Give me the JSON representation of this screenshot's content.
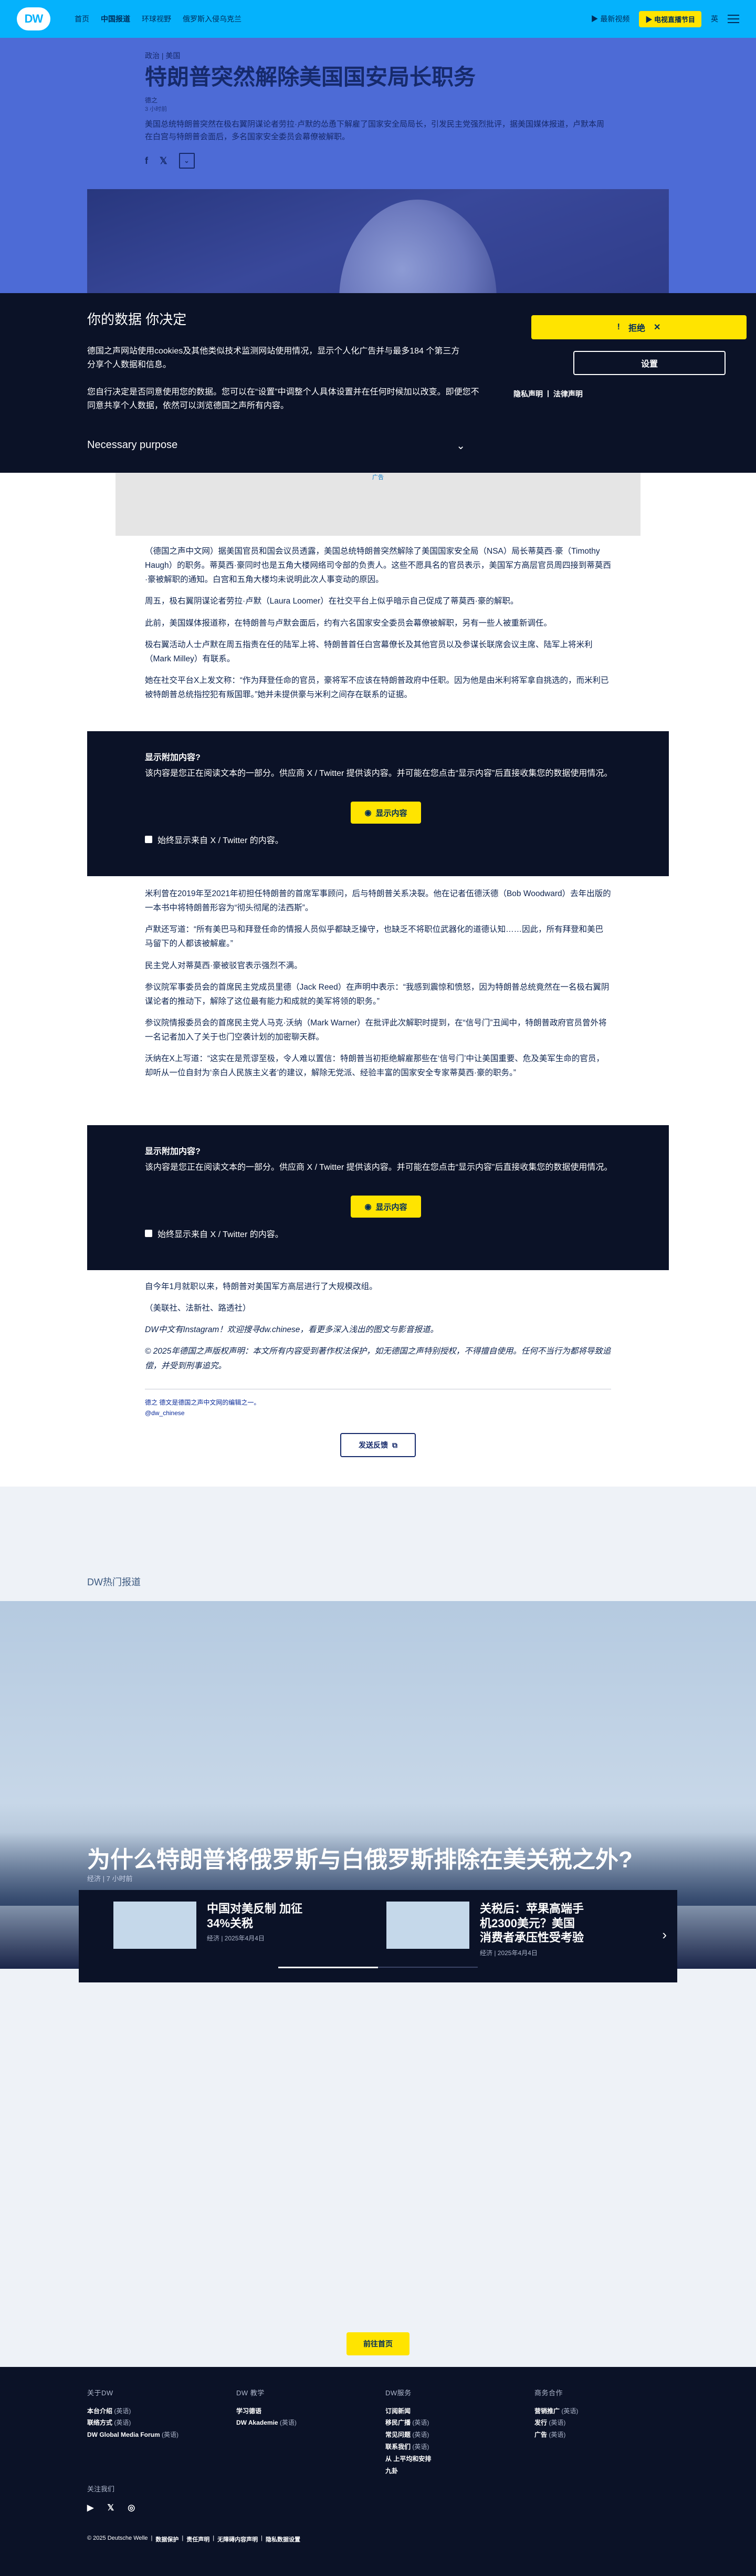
{
  "header": {
    "logo": "DW",
    "nav": [
      "首页",
      "中国报道",
      "环球视野",
      "俄罗斯入侵乌克兰"
    ],
    "active_nav": "中国报道",
    "latest_videos": "最新视频",
    "live_pill": "电视直播节目",
    "lang": "英"
  },
  "article": {
    "kicker": "政治 | 美国",
    "title": "特朗普突然解除美国国安局长职务",
    "author": "德之",
    "time": "3 小时前",
    "lead": "美国总统特朗普突然在极右翼阴谋论者劳拉·卢默的怂恿下解雇了国家安全局局长，引发民主党强烈批评，据美国媒体报道，卢默本周在白宫与特朗普会面后，多名国家安全委员会幕僚被解职。",
    "share": [
      "f",
      "𝕏",
      "⌄"
    ]
  },
  "cookie": {
    "title": "你的数据 你决定",
    "p1": "德国之声网站使用cookies及其他类似技术监测网站使用情况，显示个人化广告并与最多184 个第三方分享个人数据和信息。",
    "p2": "您自行决定是否同意使用您的数据。您可以在“设置”中调整个人具体设置并在任何时候加以改变。即便您不同意共享个人数据，依然可以浏览德国之声所有内容。",
    "purpose": "Necessary purpose",
    "reject": "拒绝",
    "settings": "设置",
    "privacy": "隐私声明",
    "legal": "法律声明"
  },
  "ad": {
    "label": "广告"
  },
  "body1": [
    "（德国之声中文网）据美国官员和国会议员透露，美国总统特朗普突然解除了美国国家安全局（NSA）局长蒂莫西·豪（Timothy Haugh）的职务。蒂莫西·豪同时也是五角大楼网络司令部的负责人。这些不愿具名的官员表示，美国军方高层官员周四接到蒂莫西·豪被解职的通知。白宫和五角大楼均未说明此次人事变动的原因。",
    "周五，极右翼阴谋论者劳拉·卢默（Laura Loomer）在社交平台上似乎暗示自己促成了蒂莫西·豪的解职。",
    "此前，美国媒体报道称，在特朗普与卢默会面后，约有六名国家安全委员会幕僚被解职，另有一些人被重新调任。",
    "极右翼活动人士卢默在周五指责在任的陆军上将、特朗普首任白宫幕僚长及其他官员以及参谋长联席会议主席、陆军上将米利（Mark Milley）有联系。",
    "她在社交平台X上发文称：“作为拜登任命的官员，豪将军不应该在特朗普政府中任职。因为他是由米利将军拿自挑选的，而米利已被特朗普总统指控犯有叛国罪。”她并未提供豪与米利之间存在联系的证据。"
  ],
  "embed": {
    "title": "显示附加内容?",
    "desc": "该内容是您正在阅读文本的一部分。供应商 X / Twitter 提供该内容。并可能在您点击“显示内容”后直接收集您的数据使用情况。",
    "button": "显示内容",
    "always": "始终显示来自 X / Twitter 的内容。"
  },
  "body2": [
    "米利曾在2019年至2021年初担任特朗普的首席军事顾问，后与特朗普关系决裂。他在记者伍德沃德（Bob Woodward）去年出版的一本书中将特朗普形容为“彻头彻尾的法西斯”。",
    "卢默还写道：“所有美巴马和拜登任命的情报人员似乎都缺乏操守，也缺乏不将职位武器化的道德认知……因此，所有拜登和美巴马留下的人都该被解雇。”",
    "民主党人对蒂莫西·豪被驳官表示强烈不满。",
    "参议院军事委员会的首席民主党成员里德（Jack Reed）在声明中表示：“我感到震惊和愤怒，因为特朗普总统竟然在一名极右翼阴谋论者的推动下，解除了这位最有能力和成就的美军将领的职务。”",
    "参议院情报委员会的首席民主党人马克·沃纳（Mark Warner）在批评此次解职时提到，在“信号门”丑闻中，特朗普政府官员曾外将一名记者加入了关于也门空袭计划的加密聊天群。",
    "沃纳在X上写道：“这实在是荒谬至极，令人难以置信：特朗普当初拒绝解雇那些在‘信号门’中让美国重要、危及美军生命的官员，却听从一位自封为‘亲白人民族主义者’的建议，解除无党派、经验丰富的国家安全专家蒂莫西·豪的职务。”"
  ],
  "body3": [
    "自今年1月就职以来，特朗普对美国军方高层进行了大规模改组。",
    "（美联社、法新社、路透社）",
    "DW中文有Instagram！欢迎搜寻dw.chinese，看更多深入浅出的图文与影音报道。",
    "© 2025年德国之声版权声明：本文所有内容受到著作权法保护，如无德国之声特别授权，不得擅自使用。任何不当行为都将导致追偿，并受到刑事追究。"
  ],
  "tags": {
    "line1": "德之 德文是德国之声中文网的编辑之一。",
    "line2": "@dw_chinese"
  },
  "feedback": "发送反馈",
  "hot": {
    "label": "DW热门报道",
    "title": "为什么特朗普将俄罗斯与白俄罗斯排除在美关税之外?",
    "meta": "经济 | 7 小时前",
    "cards": [
      {
        "title": "中国对美反制 加征34%关税",
        "meta": "经济 | 2025年4月4日"
      },
      {
        "title": "关税后：苹果高端手机2300美元？美国消费者承压性受考验",
        "meta": "经济 | 2025年4月4日"
      }
    ],
    "next": "›"
  },
  "more_button": "前往首页",
  "footer": {
    "cols": [
      {
        "heading": "关于DW",
        "items": [
          [
            "本台介绍",
            "(英语)"
          ],
          [
            "联络方式",
            "(英语)"
          ],
          [
            "DW Global Media Forum",
            "(英语)"
          ]
        ]
      },
      {
        "heading": "DW 教学",
        "items": [
          [
            "学习德语",
            ""
          ],
          [
            "DW Akademie",
            "(英语)"
          ]
        ]
      },
      {
        "heading": "DW服务",
        "items": [
          [
            "订阅新闻",
            ""
          ],
          [
            "移民广播",
            "(英语)"
          ],
          [
            "常见问题",
            "(英语)"
          ],
          [
            "联系我们",
            "(英语)"
          ],
          [
            "从 上平均和安排",
            ""
          ],
          [
            "九卦",
            ""
          ]
        ]
      },
      {
        "heading": "商务合作",
        "items": [
          [
            "营销推广",
            "(英语)"
          ],
          [
            "发行",
            "(英语)"
          ],
          [
            "广告",
            "(英语)"
          ]
        ]
      }
    ],
    "follow": "关注我们",
    "socials": [
      "▶",
      "𝕏",
      "◎"
    ],
    "legal": [
      "© 2025 Deutsche Welle",
      "数据保护",
      "责任声明",
      "无障碍内容声明",
      "隐私数据设置"
    ]
  }
}
